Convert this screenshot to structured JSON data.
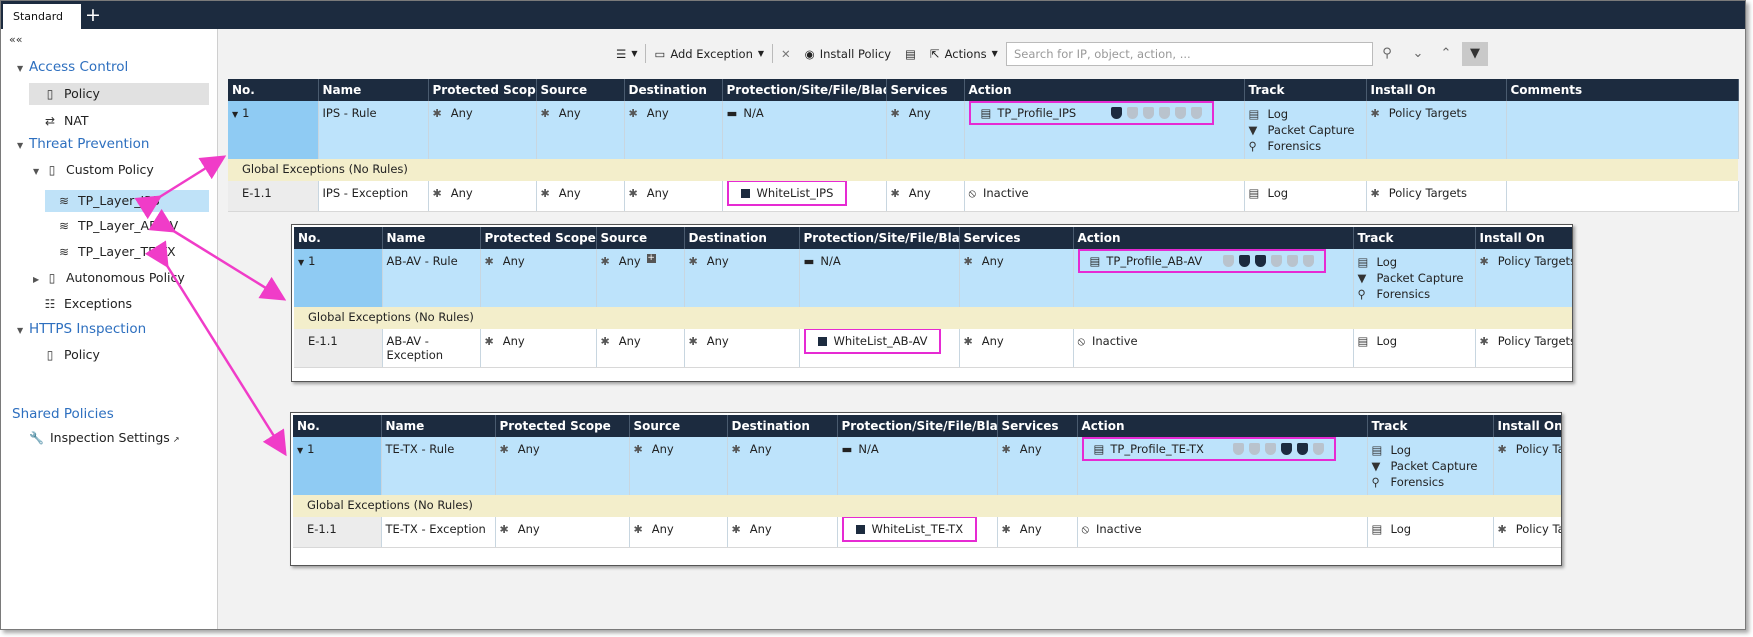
{
  "tab": {
    "label": "Standard",
    "add": "+"
  },
  "sidebar": {
    "collapse": "««",
    "access_control": "Access Control",
    "policy": "Policy",
    "nat": "NAT",
    "threat_prevention": "Threat Prevention",
    "custom_policy": "Custom Policy",
    "layer_ips": "TP_Layer_IPS",
    "layer_abav": "TP_Layer_AB-AV",
    "layer_tetx": "TP_Layer_TE-TX",
    "autonomous": "Autonomous Policy",
    "exceptions": "Exceptions",
    "https": "HTTPS Inspection",
    "https_policy": "Policy",
    "shared": "Shared Policies",
    "inspection": "Inspection Settings"
  },
  "toolbar": {
    "add_exception": "Add Exception",
    "install": "Install Policy",
    "actions": "Actions",
    "search_placeholder": "Search for IP, object, action, ..."
  },
  "headers": {
    "no": "No.",
    "name": "Name",
    "scope": "Protected Scope",
    "source": "Source",
    "dest": "Destination",
    "prot": "Protection/Site/File/Blade",
    "services": "Services",
    "action": "Action",
    "track": "Track",
    "install": "Install On",
    "comments": "Comments"
  },
  "common": {
    "any": "Any",
    "na": "N/A",
    "global_exc": "Global Exceptions (No Rules)",
    "exc_no": "E-1.1",
    "inactive": "Inactive",
    "log": "Log",
    "packet": "Packet Capture",
    "forensics": "Forensics",
    "policy_targets": "Policy Targets",
    "rule_no": "1"
  },
  "ips": {
    "rule": "IPS - Rule",
    "profile": "TP_Profile_IPS",
    "exception": "IPS - Exception",
    "whitelist": "WhiteList_IPS"
  },
  "abav": {
    "rule": "AB-AV - Rule",
    "profile": "TP_Profile_AB-AV",
    "exception": "AB-AV - Exception",
    "whitelist": "WhiteList_AB-AV"
  },
  "tetx": {
    "rule": "TE-TX - Rule",
    "profile": "TP_Profile_TE-TX",
    "exception": "TE-TX - Exception",
    "whitelist": "WhiteList_TE-TX"
  },
  "colors": {
    "header": "#1c2b3f",
    "rule_row": "#bde3fb",
    "exception_band": "#f3eecb",
    "highlight": "#e62ad3",
    "arrow": "#f03cc8"
  }
}
